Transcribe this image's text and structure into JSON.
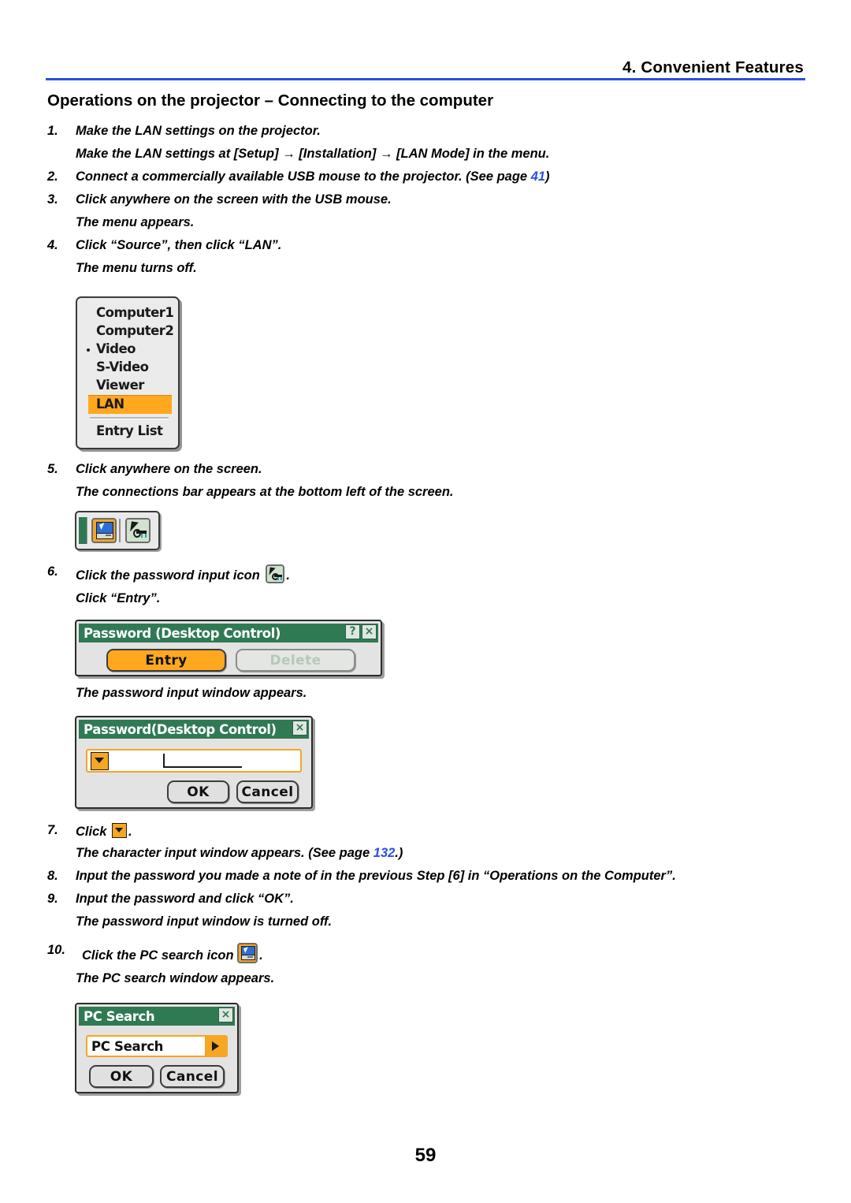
{
  "header": {
    "chapter_title": "4. Convenient Features",
    "rule_color": "#2a4fe6"
  },
  "section": {
    "title": "Operations on the projector – Connecting to the computer"
  },
  "steps": [
    {
      "number": "1.",
      "text": "Make the LAN settings on the projector.",
      "note": "Make the LAN settings at [Setup] → [Installation] → [LAN Mode] in the menu."
    },
    {
      "number": "2.",
      "text_before": "Connect a commercially available USB mouse to the projector. (See page ",
      "page_ref": "41",
      "text_after": ")"
    },
    {
      "number": "3.",
      "text": "Click anywhere on the screen with the USB mouse.",
      "note": "The menu appears."
    },
    {
      "number": "4.",
      "text": "Click “Source”, then click “LAN”.",
      "note": "The menu turns off."
    },
    {
      "number": "5.",
      "text": "Click anywhere on the screen.",
      "note": "The connections bar appears at the bottom left of the screen."
    },
    {
      "number": "6.",
      "text_before": "Click the password input icon",
      "text_after": ".",
      "note": "Click “Entry”."
    },
    {
      "number": "7.",
      "text_before": "Click",
      "text_after": ".",
      "note_before": "The character input window appears. (See page ",
      "page_ref": "132",
      "note_after": ".)"
    },
    {
      "number": "8.",
      "text": "Input the password you made a note of in the previous Step [6] in “Operations on the Computer”."
    },
    {
      "number": "9.",
      "text": "Input the password and click “OK”.",
      "note": "The password input window is turned off."
    },
    {
      "number": "10.",
      "text_before": "Click the PC search icon",
      "text_after": ".",
      "note": "The PC search window appears."
    }
  ],
  "captions": {
    "password_window_appears": "The password input window appears."
  },
  "source_menu": {
    "items": [
      {
        "label": "Computer1",
        "bullet": false,
        "selected": false
      },
      {
        "label": "Computer2",
        "bullet": false,
        "selected": false
      },
      {
        "label": "Video",
        "bullet": true,
        "selected": false
      },
      {
        "label": "S-Video",
        "bullet": false,
        "selected": false
      },
      {
        "label": "Viewer",
        "bullet": false,
        "selected": false
      },
      {
        "label": "LAN",
        "bullet": false,
        "selected": true
      },
      {
        "label": "Entry List",
        "bullet": false,
        "selected": false
      }
    ],
    "highlight_color": "#ffa81f"
  },
  "connections_bar": {
    "icons": [
      {
        "name": "pc-search-icon"
      },
      {
        "name": "password-input-icon"
      }
    ]
  },
  "dialogs": {
    "password_control": {
      "title": "Password (Desktop Control)",
      "help_button": "?",
      "close_button": "×",
      "entry_label": "Entry",
      "delete_label": "Delete"
    },
    "password_input": {
      "title": "Password(Desktop Control)",
      "close_button": "×",
      "field_value": "",
      "ok_label": "OK",
      "cancel_label": "Cancel"
    },
    "pc_search": {
      "title": "PC Search",
      "close_button": "×",
      "field_value": "PC Search",
      "ok_label": "OK",
      "cancel_label": "Cancel"
    }
  },
  "footer": {
    "page_number": "59"
  }
}
